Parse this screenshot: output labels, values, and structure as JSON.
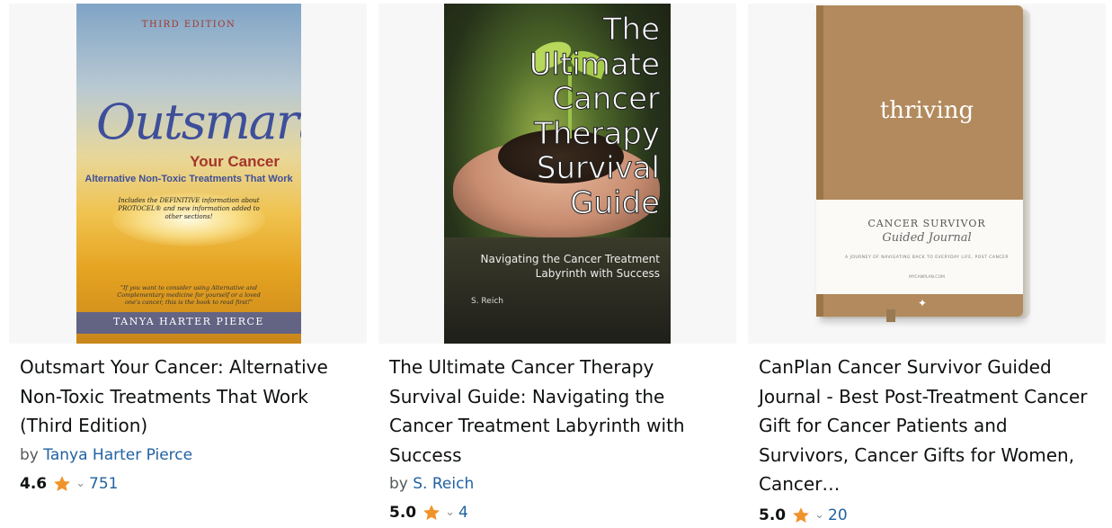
{
  "products": [
    {
      "title": "Outsmart Your Cancer: Alternative Non-Toxic Treatments That Work (Third Edition)",
      "by_label": "by",
      "author": "Tanya Harter Pierce",
      "rating": "4.6",
      "review_count": "751",
      "cover": {
        "edition": "THIRD EDITION",
        "script_title": "Outsmart",
        "your_cancer": "Your Cancer",
        "subtitle": "Alternative Non-Toxic Treatments That Work",
        "includes": "Includes the DEFINITIVE information about PROTOCEL® and new information added to other sections!",
        "quote": "\"If you want to consider using Alternative and Complementary medicine for yourself or a loved one's cancer, this is the book to read first!\"",
        "author": "TANYA HARTER PIERCE"
      }
    },
    {
      "title": "The Ultimate Cancer Therapy Survival Guide: Navigating the Cancer Treatment Labyrinth with Success",
      "by_label": "by",
      "author": "S. Reich",
      "rating": "5.0",
      "review_count": "4",
      "cover": {
        "title_lines": [
          "The",
          "Ultimate",
          "Cancer",
          "Therapy",
          "Survival",
          "Guide"
        ],
        "subtitle_1": "Navigating the Cancer Treatment",
        "subtitle_2": "Labyrinth with Success",
        "author": "S. Reich"
      }
    },
    {
      "title": "CanPlan Cancer Survivor Guided Journal - Best Post-Treatment Cancer Gift for Cancer Patients and Survivors, Cancer Gifts for Women, Cancer…",
      "rating": "5.0",
      "review_count": "20",
      "cover": {
        "front": "thriving",
        "band_title": "CANCER SURVIVOR",
        "band_script": "Guided Journal",
        "band_small": "A JOURNEY OF NAVIGATING BACK TO EVERYDAY LIFE, POST CANCER",
        "band_url": "MYCANPLAN.COM"
      }
    }
  ],
  "colors": {
    "link": "#2162a1",
    "star": "#f0932b",
    "text": "#0f1111",
    "muted": "#565959"
  },
  "icons": {
    "star": "star-icon",
    "chevron": "chevron-down-icon"
  }
}
